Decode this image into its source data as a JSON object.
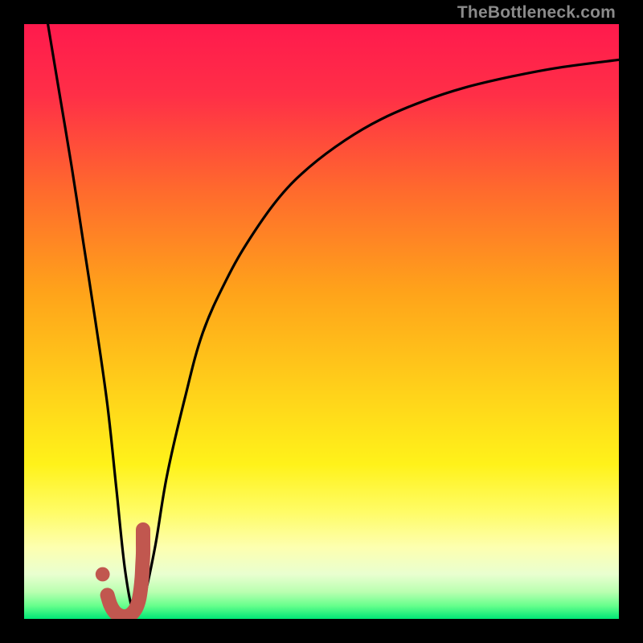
{
  "watermark": "TheBottleneck.com",
  "gradient": {
    "stops": [
      {
        "offset": 0.0,
        "color": "#ff1a4d"
      },
      {
        "offset": 0.12,
        "color": "#ff2f47"
      },
      {
        "offset": 0.28,
        "color": "#ff6a2d"
      },
      {
        "offset": 0.45,
        "color": "#ffa31a"
      },
      {
        "offset": 0.62,
        "color": "#ffd21a"
      },
      {
        "offset": 0.74,
        "color": "#fff21a"
      },
      {
        "offset": 0.82,
        "color": "#fffc66"
      },
      {
        "offset": 0.88,
        "color": "#fdffb0"
      },
      {
        "offset": 0.925,
        "color": "#e9ffd0"
      },
      {
        "offset": 0.955,
        "color": "#b9ffb0"
      },
      {
        "offset": 0.978,
        "color": "#66ff8c"
      },
      {
        "offset": 1.0,
        "color": "#00e676"
      }
    ]
  },
  "chart_data": {
    "type": "line",
    "title": "",
    "xlabel": "",
    "ylabel": "",
    "xlim": [
      0,
      100
    ],
    "ylim": [
      0,
      100
    ],
    "series": [
      {
        "name": "bottleneck-curve",
        "x": [
          4,
          6,
          8,
          10,
          12,
          14,
          15.5,
          17,
          18.5,
          20,
          22,
          24,
          27,
          30,
          34,
          38,
          43,
          48,
          54,
          60,
          67,
          74,
          82,
          90,
          100
        ],
        "values": [
          100,
          88,
          76,
          63,
          50,
          36,
          22,
          8,
          1,
          3,
          12,
          24,
          37,
          48,
          57,
          64,
          71,
          76,
          80.5,
          84,
          87,
          89.3,
          91.2,
          92.7,
          94
        ]
      }
    ],
    "marker": {
      "name": "j-marker",
      "color": "#c1574f",
      "points_x": [
        14.0,
        14.5,
        15.2,
        16.0,
        17.0,
        18.0,
        18.8,
        19.3,
        19.6,
        19.8,
        19.9,
        20.0,
        20.0,
        20.0
      ],
      "points_y": [
        4.0,
        2.4,
        1.2,
        0.6,
        0.4,
        0.8,
        1.8,
        3.2,
        5.0,
        7.0,
        9.0,
        11.0,
        13.0,
        15.0
      ],
      "dot": {
        "x": 13.2,
        "y": 7.5,
        "r": 1.2
      }
    }
  }
}
